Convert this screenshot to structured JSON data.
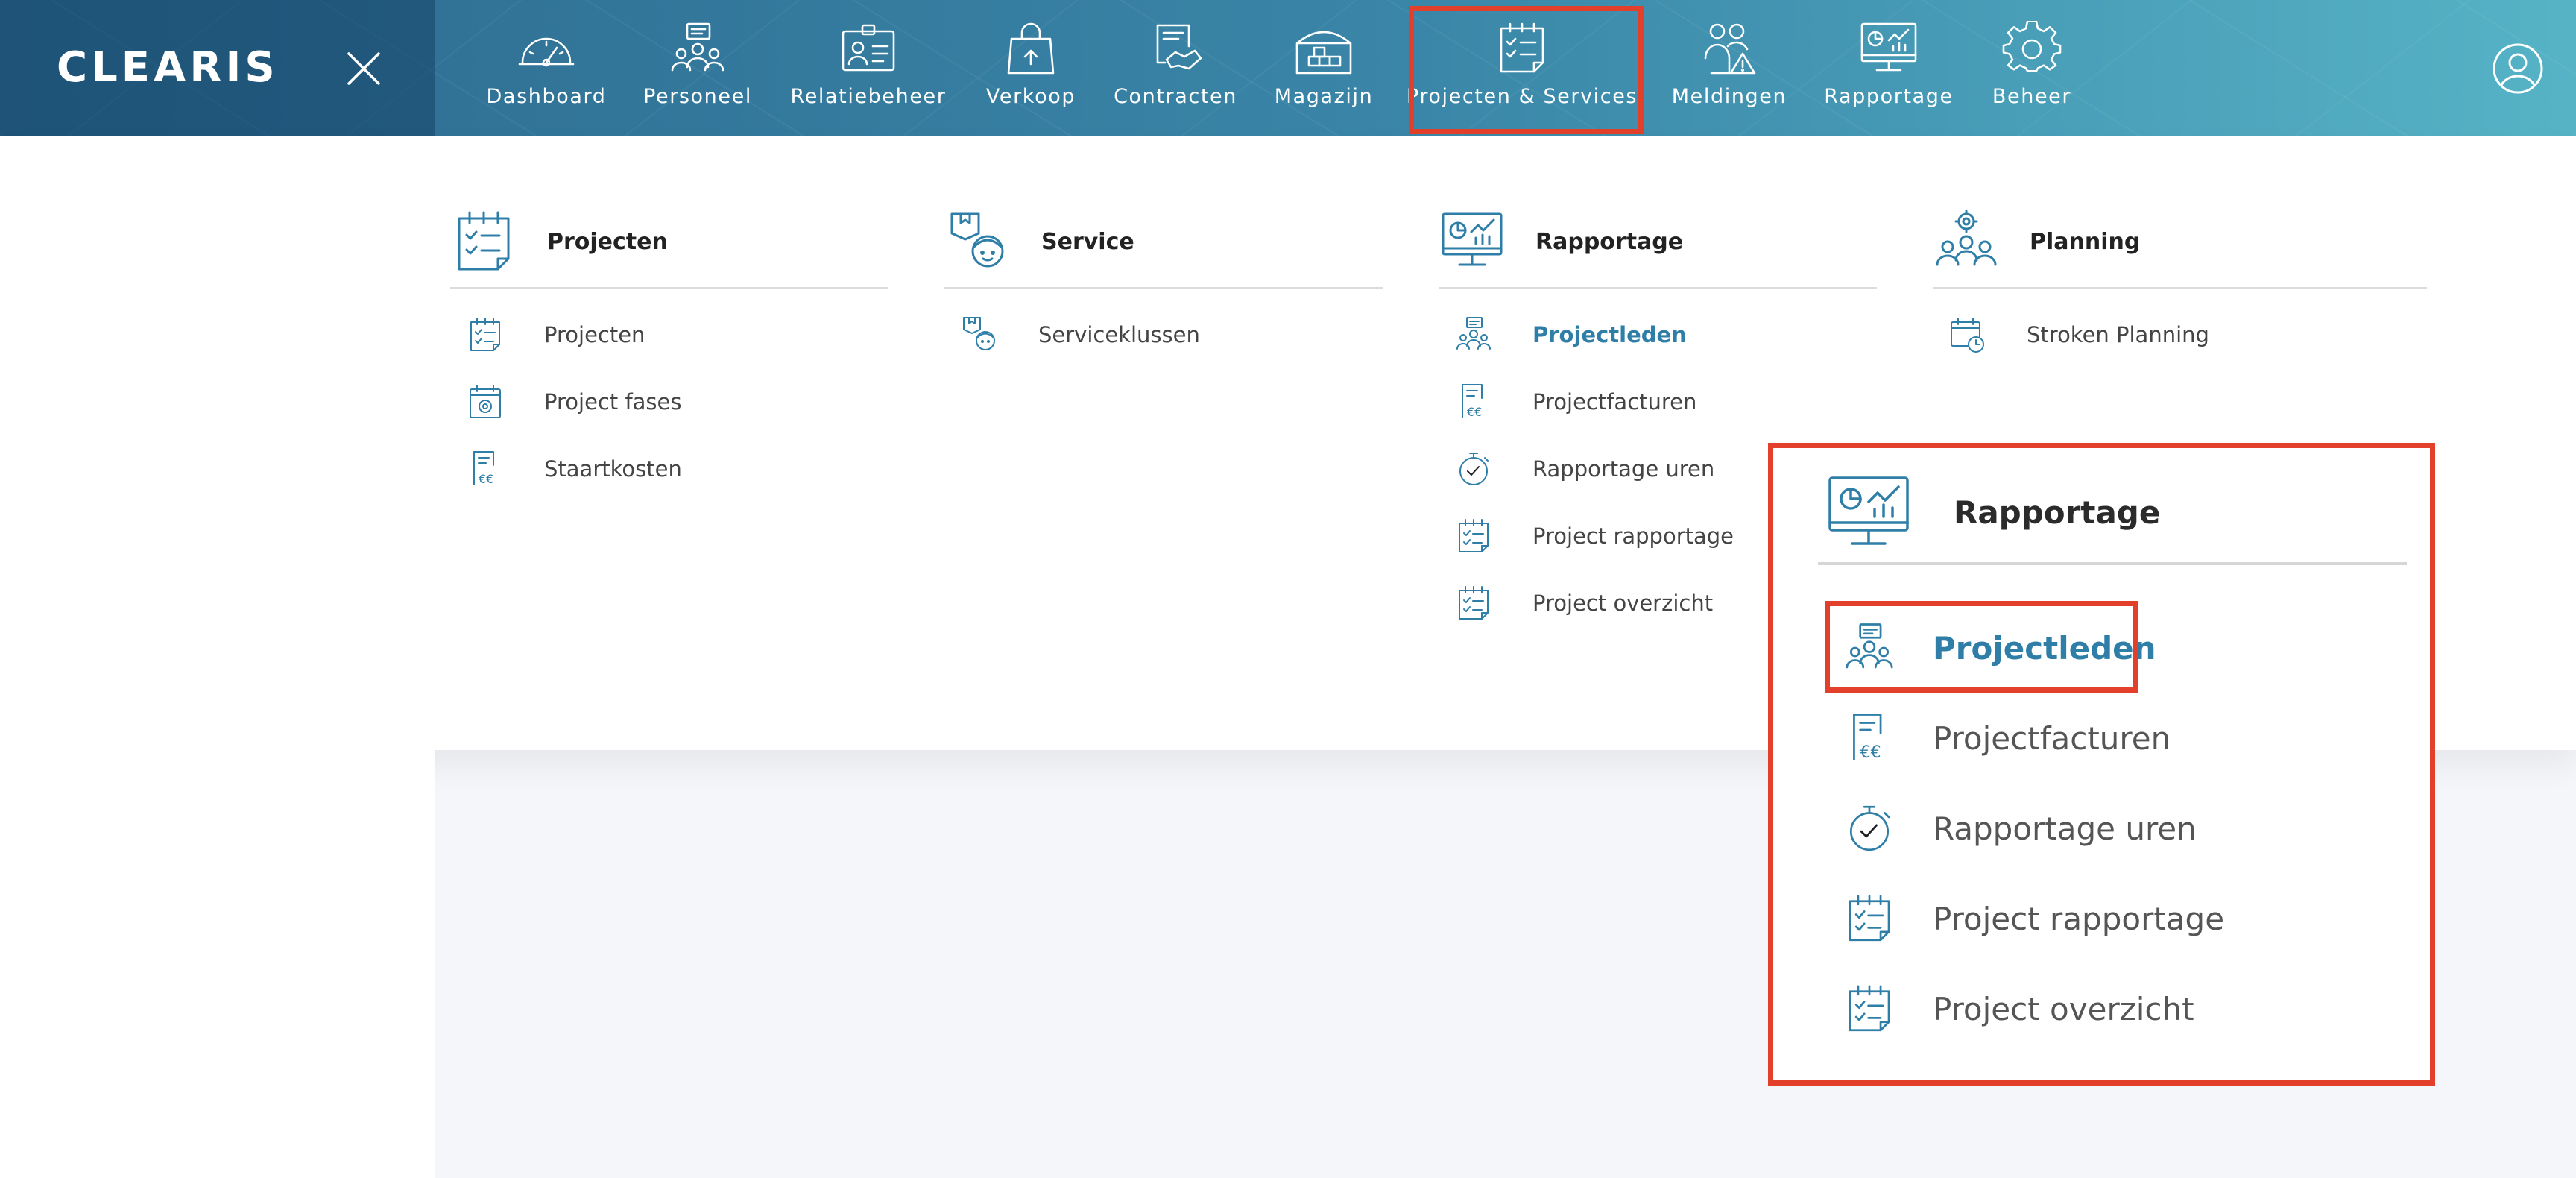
{
  "brand": {
    "logo_text": "CLEARIS"
  },
  "colors": {
    "accent": "#2e7ea8",
    "highlight": "#e2402a",
    "header_start": "#2c6a8f",
    "header_end": "#56b3c6"
  },
  "nav": [
    {
      "label": "Dashboard",
      "icon": "gauge-icon"
    },
    {
      "label": "Personeel",
      "icon": "people-icon"
    },
    {
      "label": "Relatiebeheer",
      "icon": "contact-card-icon"
    },
    {
      "label": "Verkoop",
      "icon": "shopping-bag-icon"
    },
    {
      "label": "Contracten",
      "icon": "handshake-document-icon"
    },
    {
      "label": "Magazijn",
      "icon": "warehouse-icon"
    },
    {
      "label": "Projecten & Services",
      "icon": "checklist-calendar-icon",
      "selected": true
    },
    {
      "label": "Meldingen",
      "icon": "people-warning-icon"
    },
    {
      "label": "Rapportage",
      "icon": "monitor-chart-icon"
    },
    {
      "label": "Beheer",
      "icon": "gear-icon"
    }
  ],
  "menu": {
    "columns": [
      {
        "title": "Projecten",
        "icon": "checklist-calendar-icon",
        "items": [
          {
            "label": "Projecten",
            "icon": "checklist-calendar-icon"
          },
          {
            "label": "Project fases",
            "icon": "calendar-gear-icon"
          },
          {
            "label": "Staartkosten",
            "icon": "invoice-euro-icon"
          }
        ]
      },
      {
        "title": "Service",
        "icon": "service-person-icon",
        "items": [
          {
            "label": "Serviceklussen",
            "icon": "service-person-icon"
          }
        ]
      },
      {
        "title": "Rapportage",
        "icon": "monitor-chart-icon",
        "items": [
          {
            "label": "Projectleden",
            "icon": "team-members-icon",
            "active": true
          },
          {
            "label": "Projectfacturen",
            "icon": "invoice-euro-icon"
          },
          {
            "label": "Rapportage uren",
            "icon": "stopwatch-icon"
          },
          {
            "label": "Project rapportage",
            "icon": "checklist-calendar-icon"
          },
          {
            "label": "Project overzicht",
            "icon": "checklist-calendar-icon"
          }
        ]
      },
      {
        "title": "Planning",
        "icon": "team-gear-icon",
        "items": [
          {
            "label": "Stroken Planning",
            "icon": "calendar-clock-icon"
          }
        ]
      }
    ]
  },
  "zoom": {
    "title": "Rapportage",
    "items": [
      {
        "label": "Projectleden",
        "active": true
      },
      {
        "label": "Projectfacturen"
      },
      {
        "label": "Rapportage uren"
      },
      {
        "label": "Project rapportage"
      },
      {
        "label": "Project overzicht"
      }
    ]
  }
}
